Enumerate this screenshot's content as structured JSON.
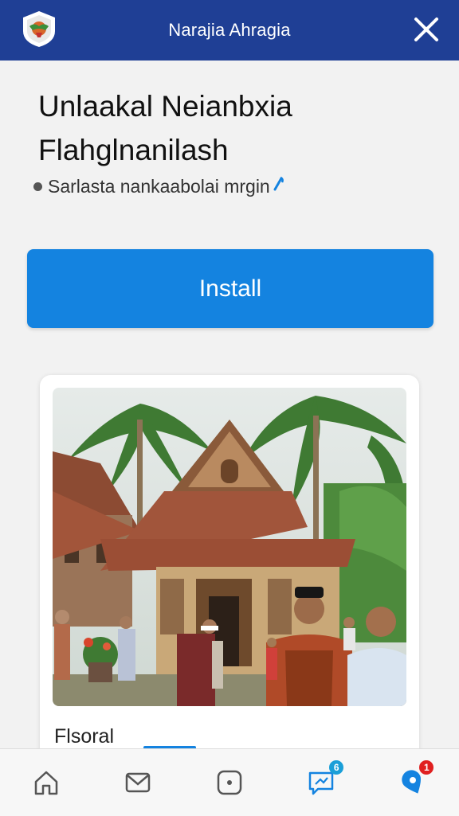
{
  "header": {
    "title": "Narajia Ahragia",
    "logo_icon": "shield-logo-icon",
    "close_icon": "close-icon",
    "background": "#1f3f95"
  },
  "headline": {
    "line1": "Unlaakal Neianbxia",
    "line2": "Flahglnanilash"
  },
  "subtitle": {
    "text": "Sarlasta nankaabolai mrgin",
    "icon": "link-icon"
  },
  "install_button": {
    "label": "Install",
    "color": "#1483e0"
  },
  "card": {
    "image_alt": "traditional wooden house with people",
    "caption": "Flsoral"
  },
  "bottom_nav": {
    "items": [
      {
        "icon": "home-icon"
      },
      {
        "icon": "mail-icon"
      },
      {
        "icon": "record-icon"
      },
      {
        "icon": "chat-icon",
        "badge": "6",
        "badge_color": "#1a9fd8"
      },
      {
        "icon": "location-icon",
        "badge": "1",
        "badge_color": "#e02020"
      }
    ]
  }
}
